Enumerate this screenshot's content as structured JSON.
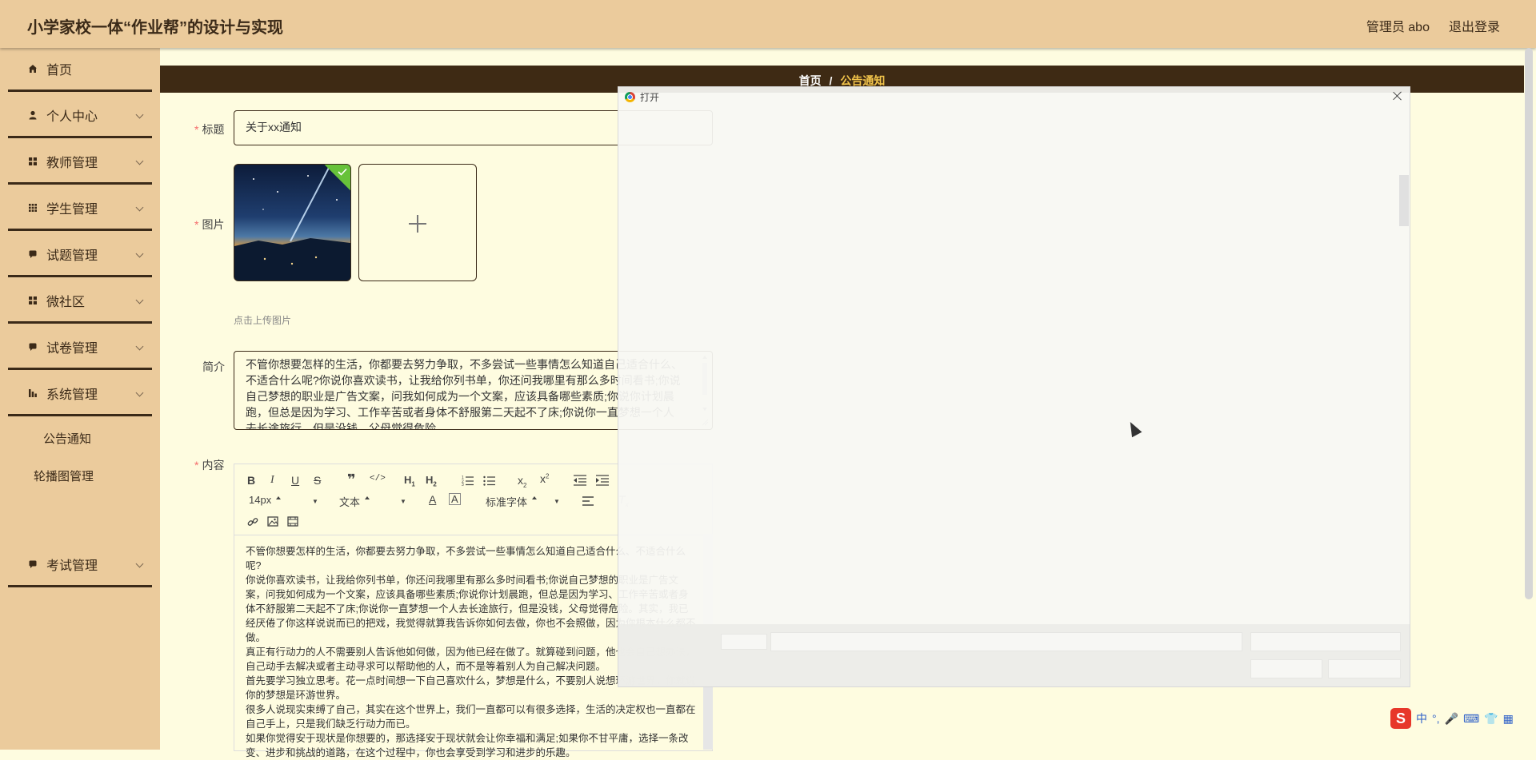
{
  "header": {
    "title": "小学家校一体“作业帮”的设计与实现",
    "user": "管理员 abo",
    "logout": "退出登录"
  },
  "sidebar": {
    "items": [
      {
        "label": "首页",
        "icon": "home-icon",
        "has_chevron": false
      },
      {
        "label": "个人中心",
        "icon": "user-icon",
        "has_chevron": true
      },
      {
        "label": "教师管理",
        "icon": "grid-icon",
        "has_chevron": true
      },
      {
        "label": "学生管理",
        "icon": "grid9-icon",
        "has_chevron": true
      },
      {
        "label": "试题管理",
        "icon": "chat-icon",
        "has_chevron": true
      },
      {
        "label": "微社区",
        "icon": "grid-icon",
        "has_chevron": true
      },
      {
        "label": "试卷管理",
        "icon": "chat-icon",
        "has_chevron": true
      },
      {
        "label": "系统管理",
        "icon": "chart-icon",
        "has_chevron": true
      }
    ],
    "sub_items": [
      "公告通知",
      "轮播图管理"
    ],
    "last_item": {
      "label": "考试管理",
      "icon": "chat-icon",
      "has_chevron": true
    }
  },
  "breadcrumb": {
    "home": "首页",
    "separator": "/",
    "current": "公告通知"
  },
  "form": {
    "title_label": "标题",
    "title_value": "关于xx通知",
    "image_label": "图片",
    "upload_tip": "点击上传图片",
    "summary_label": "简介",
    "summary_text": "不管你想要怎样的生活，你都要去努力争取，不多尝试一些事情怎么知道自己适合什么、不适合什么呢?你说你喜欢读书，让我给你列书单，你还问我哪里有那么多时间看书;你说自己梦想的职业是广告文案，问我如何成为一个文案，应该具备哪些素质;你说你计划晨跑，但总是因为学习、工作辛苦或者身体不舒服第二天起不了床;你说你一直梦想一个人去长途旅行，但是没钱，父母觉得危险。",
    "content_label": "内容"
  },
  "editor": {
    "font_size": "14px",
    "block_type": "文本",
    "font_family": "标准字体",
    "paragraphs": [
      "不管你想要怎样的生活，你都要去努力争取，不多尝试一些事情怎么知道自己适合什么、不适合什么呢?",
      "你说你喜欢读书，让我给你列书单，你还问我哪里有那么多时间看书;你说自己梦想的职业是广告文案，问我如何成为一个文案，应该具备哪些素质;你说你计划晨跑，但总是因为学习、工作辛苦或者身体不舒服第二天起不了床;你说你一直梦想一个人去长途旅行，但是没钱，父母觉得危险。其实，我已经厌倦了你这样说说而已的把戏，我觉得就算我告诉你如何去做，你也不会照做，因为你根本什么都不做。",
      "真正有行动力的人不需要别人告诉他如何做，因为他已经在做了。就算碰到问题，他也会自己想办法，自己动手去解决或者主动寻求可以帮助他的人，而不是等着别人为自己解决问题。",
      "首先要学习独立思考。花一点时间想一下自己喜欢什么，梦想是什么，不要别人说想环游世界，你就说你的梦想是环游世界。",
      "很多人说现实束缚了自己，其实在这个世界上，我们一直都可以有很多选择，生活的决定权也一直都在自己手上，只是我们缺乏行动力而已。",
      "如果你觉得安于现状是你想要的，那选择安于现状就会让你幸福和满足;如果你不甘平庸，选择一条改变、进步和挑战的道路，在这个过程中，你也会享受到学习和进步的乐趣。"
    ]
  },
  "dialog": {
    "title": "打开"
  },
  "tray": {
    "ime": "中"
  }
}
